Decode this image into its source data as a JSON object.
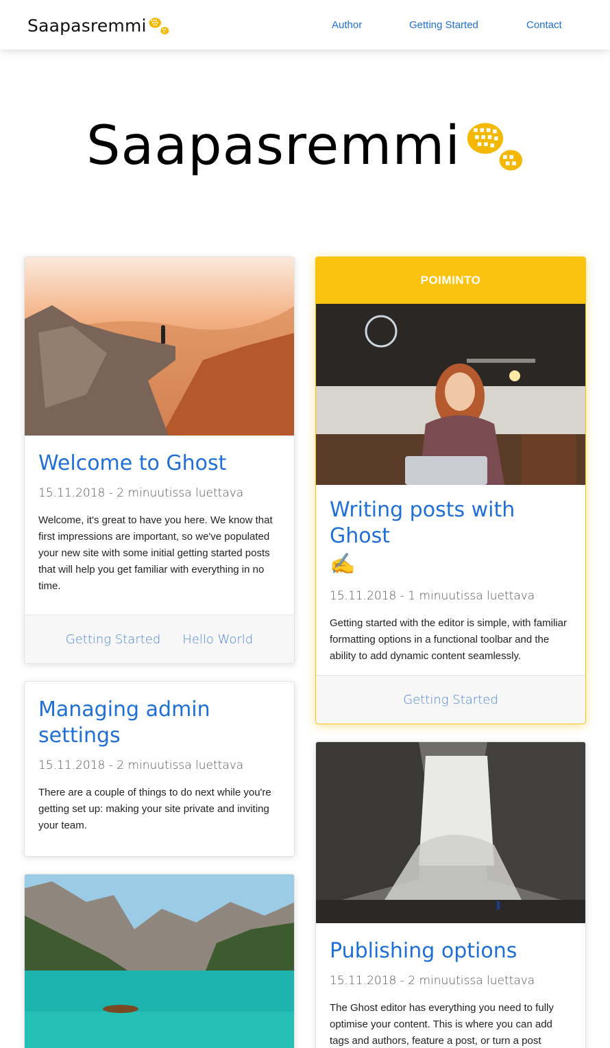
{
  "nav": {
    "brand": "Saapasremmi",
    "links": [
      "Author",
      "Getting Started",
      "Contact"
    ]
  },
  "hero": {
    "brand": "Saapasremmi"
  },
  "posts": [
    {
      "title": "Welcome to Ghost",
      "meta": "15.11.2018 - 2 minuutissa luettava",
      "excerpt": "Welcome, it's great to have you here. We know that first impressions are important, so we've populated your new site with some initial getting started posts that will help you get familiar with everything in no time.",
      "tags": [
        "Getting Started",
        "Hello World"
      ]
    },
    {
      "banner": "POIMINTO",
      "title": "Writing posts with Ghost",
      "title_emoji": "✍️",
      "meta": "15.11.2018 - 1 minuutissa luettava",
      "excerpt": "Getting started with the editor is simple, with familiar formatting options in a functional toolbar and the ability to add dynamic content seamlessly.",
      "tags": [
        "Getting Started"
      ]
    },
    {
      "title": "Managing admin settings",
      "meta": "15.11.2018 - 2 minuutissa luettava",
      "excerpt": "There are a couple of things to do next while you're getting set up: making your site private and inviting your team."
    },
    {
      "title": "Publishing options",
      "meta": "15.11.2018 - 2 minuutissa luettava",
      "excerpt": "The Ghost editor has everything you need to fully optimise your content. This is where you can add tags and authors, feature a post, or turn a post"
    }
  ],
  "colors": {
    "accent": "#1f6fd6",
    "featured": "#fbc20f",
    "logo_boot": "#f5b800"
  }
}
